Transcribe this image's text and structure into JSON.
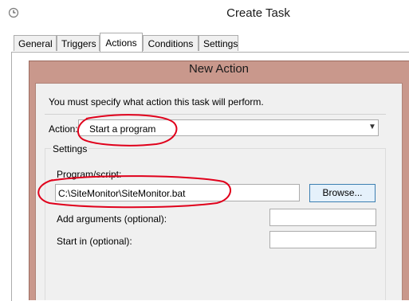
{
  "outer_window": {
    "title": "Create Task",
    "icon": "clock-icon",
    "tabs": [
      {
        "label": "General",
        "active": false
      },
      {
        "label": "Triggers",
        "active": false
      },
      {
        "label": "Actions",
        "active": true
      },
      {
        "label": "Conditions",
        "active": false
      },
      {
        "label": "Settings",
        "active": false
      }
    ]
  },
  "dialog": {
    "title": "New Action",
    "instruction": "You must specify what action this task will perform.",
    "action": {
      "label": "Action:",
      "selected": "Start a program",
      "icon": "chevron-down-icon"
    },
    "settings": {
      "group_label": "Settings",
      "program_label": "Program/script:",
      "program_value": "C:\\SiteMonitor\\SiteMonitor.bat",
      "browse_label": "Browse...",
      "arguments_label": "Add arguments (optional):",
      "arguments_value": "",
      "start_in_label": "Start in (optional):",
      "start_in_value": ""
    }
  },
  "colors": {
    "dialog_frame": "#c9988c",
    "annotation": "#e0001b",
    "button_border": "#3c7fb1"
  }
}
